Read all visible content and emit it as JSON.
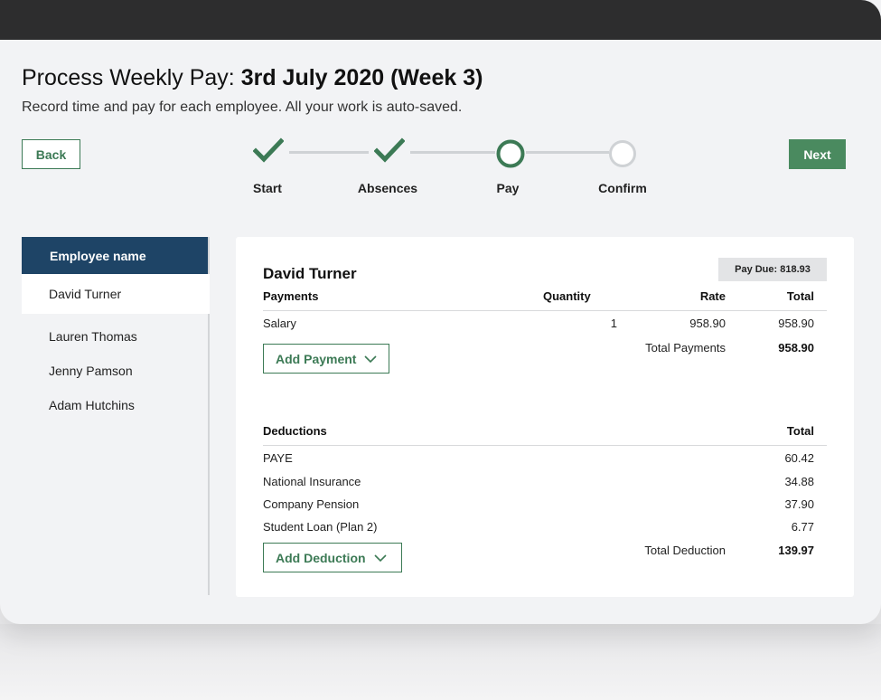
{
  "header": {
    "title_prefix": "Process Weekly Pay: ",
    "title_bold": "3rd July 2020 (Week 3)",
    "subtitle": "Record time and pay for each employee. All your work is auto-saved."
  },
  "nav": {
    "back_label": "Back",
    "next_label": "Next"
  },
  "stepper": {
    "steps": [
      {
        "label": "Start",
        "state": "done"
      },
      {
        "label": "Absences",
        "state": "done"
      },
      {
        "label": "Pay",
        "state": "current"
      },
      {
        "label": "Confirm",
        "state": "pending"
      }
    ]
  },
  "sidebar": {
    "heading": "Employee name",
    "items": [
      {
        "label": "David Turner",
        "active": true
      },
      {
        "label": "Lauren Thomas",
        "active": false
      },
      {
        "label": "Jenny Pamson",
        "active": false
      },
      {
        "label": "Adam Hutchins",
        "active": false
      }
    ]
  },
  "panel": {
    "employee_name": "David Turner",
    "pay_due": "Pay Due: 818.93",
    "payments": {
      "headers": {
        "name": "Payments",
        "quantity": "Quantity",
        "rate": "Rate",
        "total": "Total"
      },
      "rows": [
        {
          "name": "Salary",
          "quantity": "1",
          "rate": "958.90",
          "total": "958.90"
        }
      ],
      "total_label": "Total Payments",
      "total_value": "958.90",
      "add_label": "Add Payment"
    },
    "deductions": {
      "headers": {
        "name": "Deductions",
        "total": "Total"
      },
      "rows": [
        {
          "name": "PAYE",
          "total": "60.42"
        },
        {
          "name": "National Insurance",
          "total": "34.88"
        },
        {
          "name": "Company Pension",
          "total": "37.90"
        },
        {
          "name": "Student Loan (Plan 2)",
          "total": "6.77"
        }
      ],
      "total_label": "Total Deduction",
      "total_value": "139.97",
      "add_label": "Add Deduction"
    }
  },
  "colors": {
    "accent_green": "#4a8a5f",
    "navy": "#1e4466",
    "topbar": "#2d2d2e"
  }
}
